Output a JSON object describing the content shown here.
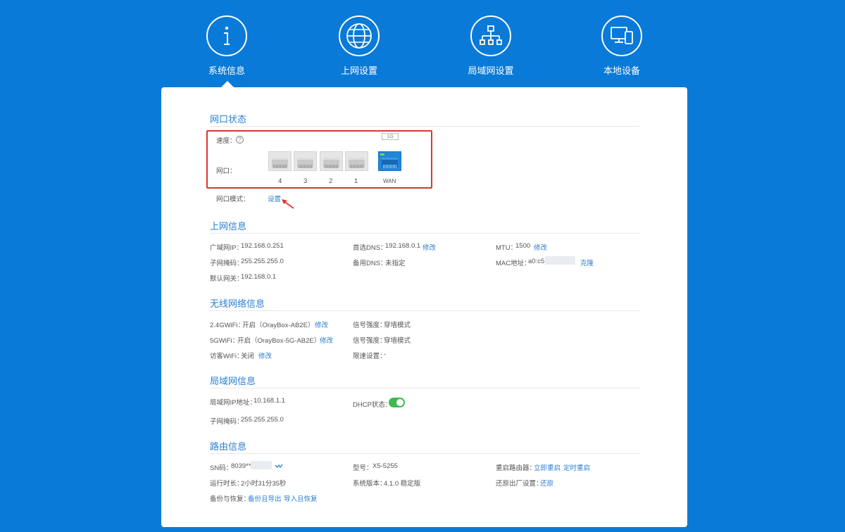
{
  "nav": {
    "items": [
      {
        "label": "系统信息",
        "icon": "info-icon"
      },
      {
        "label": "上网设置",
        "icon": "globe-icon"
      },
      {
        "label": "局域网设置",
        "icon": "network-topology-icon"
      },
      {
        "label": "本地设备",
        "icon": "devices-icon"
      }
    ],
    "active_index": 0
  },
  "port_status": {
    "title": "网口状态",
    "speed_label": "速度：",
    "speed_badge": "1G",
    "port_label": "网口：",
    "ports": [
      "4",
      "3",
      "2",
      "1",
      "WAN"
    ],
    "port_mode_label": "网口模式：",
    "port_mode_link": "设置"
  },
  "internet": {
    "title": "上网信息",
    "wan_ip_label": "广域网IP：",
    "wan_ip": "192.168.0.251",
    "subnet_label": "子网掩码：",
    "subnet": "255.255.255.0",
    "gateway_label": "默认网关：",
    "gateway": "192.168.0.1",
    "dns1_label": "首选DNS：",
    "dns1": "192.168.0.1",
    "dns2_label": "备用DNS：",
    "dns2": "未指定",
    "mtu_label": "MTU：",
    "mtu": "1500",
    "mac_label": "MAC地址：",
    "mac": "a0:c5",
    "edit": "修改",
    "clone": "克隆"
  },
  "wireless": {
    "title": "无线网络信息",
    "wifi24_label": "2.4GWiFi：",
    "wifi24": "开启（OrayBox-AB2E）",
    "wifi5_label": "5GWiFi：",
    "wifi5": "开启（OrayBox-5G-AB2E）",
    "guest_label": "访客WiFi：",
    "guest": "关闭",
    "signal_label": "信号强度：",
    "signal_24": "穿墙模式",
    "signal_5": "穿墙模式",
    "limit_label": "限速设置：",
    "limit": "-",
    "edit": "修改"
  },
  "lan": {
    "title": "局域网信息",
    "ip_label": "局域网IP地址：",
    "ip": "10.168.1.1",
    "subnet_label": "子网掩码：",
    "subnet": "255.255.255.0",
    "dhcp_label": "DHCP状态：",
    "dhcp_on": true
  },
  "router": {
    "title": "路由信息",
    "sn_label": "SN码：",
    "sn": "8039**",
    "model_label": "型号：",
    "model": "X5-5255",
    "reboot_label": "重启路由器：",
    "reboot_now": "立即重启",
    "reboot_timed": "定时重启",
    "uptime_label": "运行时长：",
    "uptime": "2小时31分35秒",
    "version_label": "系统版本：",
    "version": "4.1.0 稳定版",
    "reset_label": "还原出厂设置：",
    "reset": "还原",
    "backup_label": "备份与恢复：",
    "backup_export": "备份且导出",
    "backup_import": "导入且恢复"
  },
  "colors": {
    "background": "#0a7ad8",
    "accent": "#2a7fd0",
    "highlight_box": "#e23232",
    "toggle_on": "#3dba4e"
  }
}
